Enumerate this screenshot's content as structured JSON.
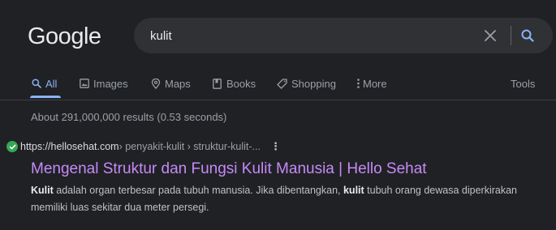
{
  "header": {
    "logo": "Google",
    "search": {
      "value": "kulit"
    }
  },
  "tabs": [
    {
      "label": "All",
      "icon": "search-icon",
      "active": true
    },
    {
      "label": "Images",
      "icon": "image-icon",
      "active": false
    },
    {
      "label": "Maps",
      "icon": "map-pin-icon",
      "active": false
    },
    {
      "label": "Books",
      "icon": "book-icon",
      "active": false
    },
    {
      "label": "Shopping",
      "icon": "tag-icon",
      "active": false
    },
    {
      "label": "More",
      "icon": "more-vert-icon",
      "active": false
    }
  ],
  "tools_label": "Tools",
  "stats": "About 291,000,000 results (0.53 seconds)",
  "result": {
    "site_url": "https://hellosehat.com",
    "site_path": " › penyakit-kulit › struktur-kulit-...",
    "title": "Mengenal Struktur dan Fungsi Kulit Manusia | Hello Sehat",
    "snippet_parts": [
      {
        "text": "Kulit",
        "bold": true
      },
      {
        "text": " adalah organ terbesar pada tubuh manusia. Jika dibentangkan, ",
        "bold": false
      },
      {
        "text": "kulit",
        "bold": true
      },
      {
        "text": " tubuh orang dewasa diperkirakan memiliki luas sekitar dua meter persegi.",
        "bold": false
      }
    ]
  },
  "colors": {
    "background": "#202124",
    "accent": "#8ab4f8",
    "visited_link": "#c58af9",
    "verified": "#34a853"
  }
}
